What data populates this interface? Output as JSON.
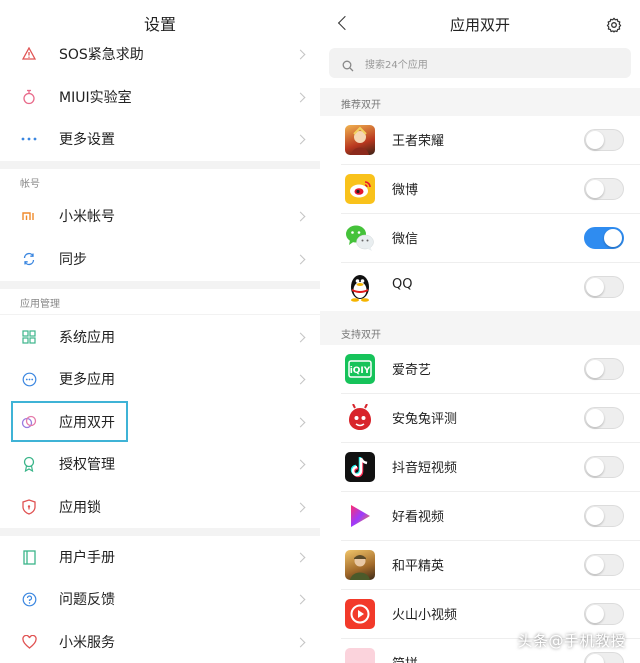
{
  "left": {
    "title": "设置",
    "group1": [
      {
        "label": "SOS紧急求助",
        "icon": "warning-triangle-icon"
      },
      {
        "label": "MIUI实验室",
        "icon": "flask-icon"
      },
      {
        "label": "更多设置",
        "icon": "more-dots-icon"
      }
    ],
    "account_caption": "帐号",
    "group2": [
      {
        "label": "小米帐号",
        "icon": "mi-logo-icon"
      },
      {
        "label": "同步",
        "icon": "sync-icon"
      }
    ],
    "apps_caption": "应用管理",
    "group3": [
      {
        "label": "系统应用",
        "icon": "grid-icon"
      },
      {
        "label": "更多应用",
        "icon": "more-circle-icon"
      },
      {
        "label": "应用双开",
        "icon": "dual-circles-icon"
      },
      {
        "label": "授权管理",
        "icon": "badge-icon"
      },
      {
        "label": "应用锁",
        "icon": "shield-lock-icon"
      }
    ],
    "group4": [
      {
        "label": "用户手册",
        "icon": "book-icon"
      },
      {
        "label": "问题反馈",
        "icon": "question-icon"
      },
      {
        "label": "小米服务",
        "icon": "heart-icon"
      }
    ]
  },
  "right": {
    "title": "应用双开",
    "search_placeholder": "搜索24个应用",
    "recommended_caption": "推荐双开",
    "recommended": [
      {
        "label": "王者荣耀",
        "icon": "honor-of-kings-icon",
        "enabled": false
      },
      {
        "label": "微博",
        "icon": "weibo-icon",
        "enabled": false
      },
      {
        "label": "微信",
        "icon": "wechat-icon",
        "enabled": true
      },
      {
        "label": "QQ",
        "icon": "qq-penguin-icon",
        "enabled": false
      }
    ],
    "supported_caption": "支持双开",
    "supported": [
      {
        "label": "爱奇艺",
        "icon": "iqiyi-icon",
        "enabled": false
      },
      {
        "label": "安兔兔评测",
        "icon": "antutu-icon",
        "enabled": false
      },
      {
        "label": "抖音短视频",
        "icon": "douyin-icon",
        "enabled": false
      },
      {
        "label": "好看视频",
        "icon": "haokan-icon",
        "enabled": false
      },
      {
        "label": "和平精英",
        "icon": "peace-elite-icon",
        "enabled": false
      },
      {
        "label": "火山小视频",
        "icon": "huoshan-icon",
        "enabled": false
      },
      {
        "label": "简拼",
        "icon": "jianpin-icon",
        "enabled": false
      }
    ]
  },
  "colors": {
    "accent": "#2f8cf0",
    "highlight": "#3fb3d6"
  },
  "watermark": "头条@手机教授"
}
